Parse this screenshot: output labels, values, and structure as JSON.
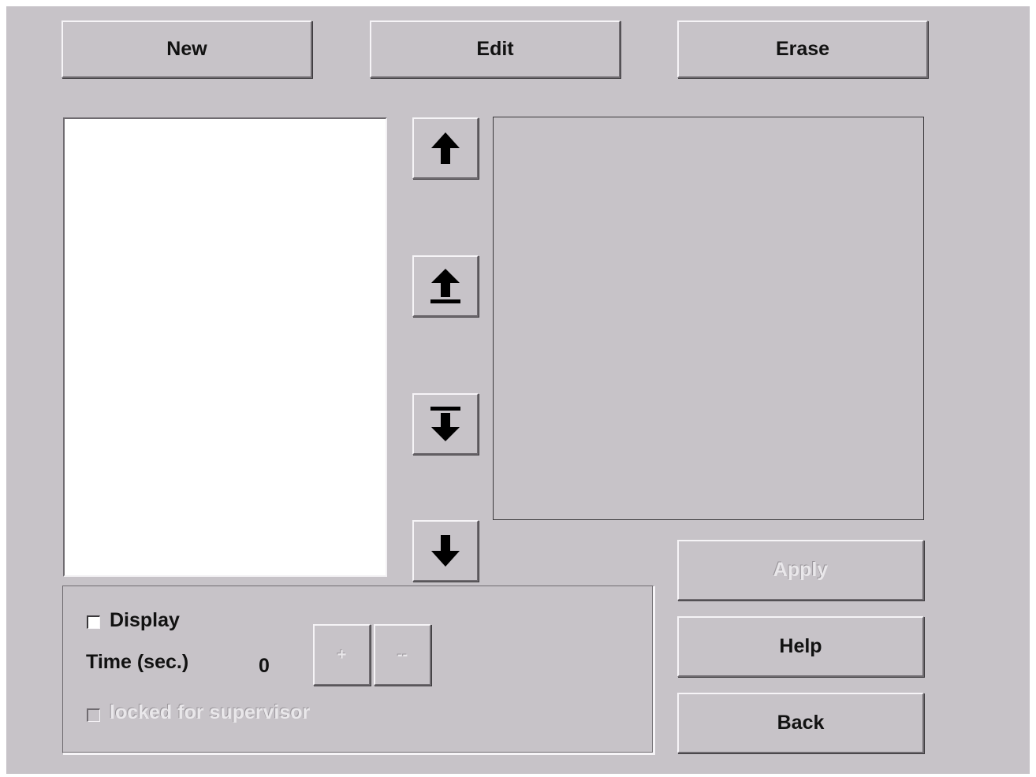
{
  "toolbar": {
    "new_label": "New",
    "edit_label": "Edit",
    "erase_label": "Erase"
  },
  "arrows": [
    {
      "name": "move-up",
      "icon": "arrow-up-icon"
    },
    {
      "name": "move-to-top",
      "icon": "arrow-up-to-top-icon"
    },
    {
      "name": "move-to-bottom",
      "icon": "arrow-down-to-bottom-icon"
    },
    {
      "name": "move-down",
      "icon": "arrow-down-icon"
    }
  ],
  "actions": {
    "apply_label": "Apply",
    "help_label": "Help",
    "back_label": "Back"
  },
  "settings": {
    "display_label": "Display",
    "display_checked": false,
    "time_label": "Time (sec.)",
    "time_value": "0",
    "plus_label": "+",
    "minus_label": "--",
    "locked_label": "locked for supervisor",
    "locked_checked": false
  },
  "colors": {
    "background": "#c7c3c8",
    "list_background": "#ffffff"
  }
}
